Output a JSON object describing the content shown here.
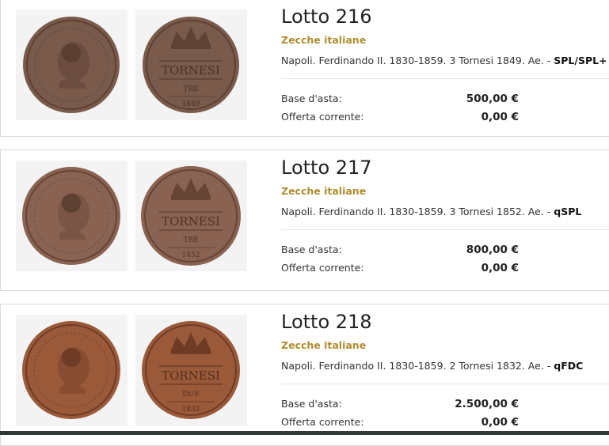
{
  "lots": [
    {
      "title": "Lotto 216",
      "category": "Zecche italiane",
      "description": "Napoli. Ferdinando II. 1830-1859. 3 Tornesi 1849. Ae. - ",
      "grade": "SPL/SPL+",
      "base_label": "Base d'asta:",
      "base_value": "500,00 €",
      "offer_label": "Offerta corrente:",
      "offer_value": "0,00 €",
      "coin": {
        "tone": "#7a5a4a",
        "rev_denomination": "TORNESI",
        "rev_value": "TRE",
        "rev_year": "1849"
      }
    },
    {
      "title": "Lotto 217",
      "category": "Zecche italiane",
      "description": "Napoli. Ferdinando II. 1830-1859. 3 Tornesi 1852. Ae. - ",
      "grade": "qSPL",
      "base_label": "Base d'asta:",
      "base_value": "800,00 €",
      "offer_label": "Offerta corrente:",
      "offer_value": "0,00 €",
      "coin": {
        "tone": "#8a6252",
        "rev_denomination": "TORNESI",
        "rev_value": "TRE",
        "rev_year": "1852"
      }
    },
    {
      "title": "Lotto 218",
      "category": "Zecche italiane",
      "description": "Napoli. Ferdinando II. 1830-1859. 2 Tornesi 1832. Ae. - ",
      "grade": "qFDC",
      "base_label": "Base d'asta:",
      "base_value": "2.500,00 €",
      "offer_label": "Offerta corrente:",
      "offer_value": "0,00 €",
      "coin": {
        "tone": "#9a5a3a",
        "rev_denomination": "TORNESI",
        "rev_value": "DUE",
        "rev_year": "1832"
      }
    }
  ]
}
